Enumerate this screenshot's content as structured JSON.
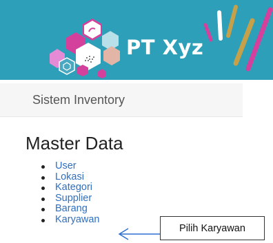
{
  "header": {
    "brand": "PT Xyz"
  },
  "navbar": {
    "title": "Sistem Inventory"
  },
  "main": {
    "heading": "Master Data",
    "menu": [
      "User",
      "Lokasi",
      "Kategori",
      "Supplier",
      "Barang",
      "Karyawan"
    ]
  },
  "annotation": {
    "label": "Pilih Karyawan"
  },
  "colors": {
    "banner": "#2e9fb8",
    "link": "#2f6fc0",
    "arrow": "#2e6fd0"
  }
}
